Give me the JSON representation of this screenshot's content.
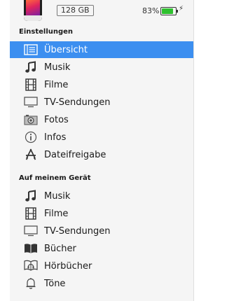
{
  "device": {
    "capacity": "128 GB",
    "battery_percent": "83%",
    "battery_level": 0.83,
    "charging_symbol": "⚡",
    "battery_color": "#2ec02e"
  },
  "sections": [
    {
      "title": "Einstellungen",
      "items": [
        {
          "label": "Übersicht",
          "icon": "summary-list-icon",
          "selected": true
        },
        {
          "label": "Musik",
          "icon": "music-note-icon",
          "selected": false
        },
        {
          "label": "Filme",
          "icon": "film-icon",
          "selected": false
        },
        {
          "label": "TV-Sendungen",
          "icon": "tv-icon",
          "selected": false
        },
        {
          "label": "Fotos",
          "icon": "camera-icon",
          "selected": false
        },
        {
          "label": "Infos",
          "icon": "info-icon",
          "selected": false
        },
        {
          "label": "Dateifreigabe",
          "icon": "app-store-icon",
          "selected": false
        }
      ]
    },
    {
      "title": "Auf meinem Gerät",
      "items": [
        {
          "label": "Musik",
          "icon": "music-note-icon",
          "selected": false
        },
        {
          "label": "Filme",
          "icon": "film-icon",
          "selected": false
        },
        {
          "label": "TV-Sendungen",
          "icon": "tv-icon",
          "selected": false
        },
        {
          "label": "Bücher",
          "icon": "book-icon",
          "selected": false
        },
        {
          "label": "Hörbücher",
          "icon": "audiobook-icon",
          "selected": false
        },
        {
          "label": "Töne",
          "icon": "bell-icon",
          "selected": false
        }
      ]
    }
  ],
  "colors": {
    "selected_background": "#3c8ff0",
    "sidebar_background": "#f5f5f5"
  }
}
